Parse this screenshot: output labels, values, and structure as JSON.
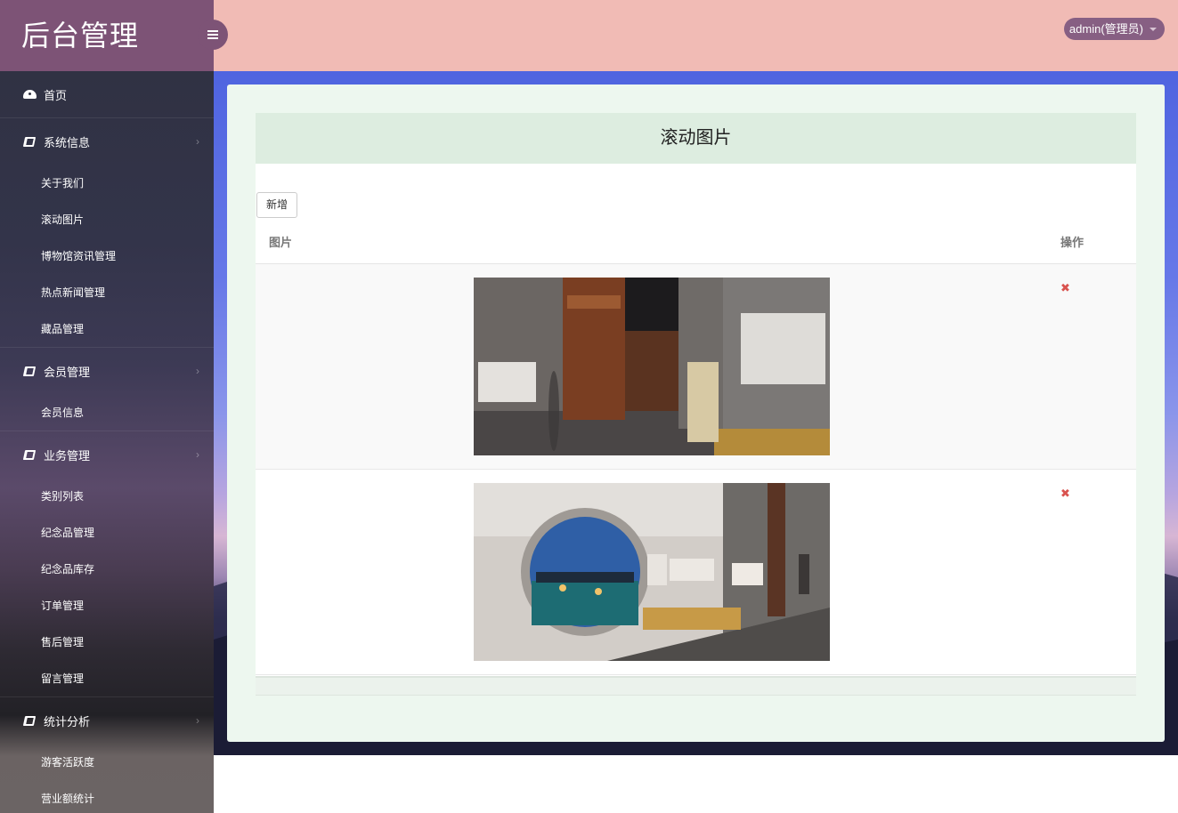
{
  "brand": {
    "title": "后台管理"
  },
  "topbar": {
    "user_label": "admin(管理员)"
  },
  "sidebar": {
    "home": {
      "label": "首页",
      "icon": "dashboard-icon"
    },
    "groups": [
      {
        "label": "系统信息",
        "icon": "book-icon",
        "items": [
          "关于我们",
          "滚动图片",
          "博物馆资讯管理",
          "热点新闻管理",
          "藏品管理"
        ]
      },
      {
        "label": "会员管理",
        "icon": "book-icon",
        "items": [
          "会员信息"
        ]
      },
      {
        "label": "业务管理",
        "icon": "book-icon",
        "items": [
          "类别列表",
          "纪念品管理",
          "纪念品库存",
          "订单管理",
          "售后管理",
          "留言管理"
        ]
      },
      {
        "label": "统计分析",
        "icon": "book-icon",
        "items": [
          "游客活跃度",
          "营业额统计"
        ]
      }
    ]
  },
  "panel": {
    "title": "滚动图片",
    "add_label": "新增",
    "columns": [
      "图片",
      "操作"
    ],
    "rows": [
      {
        "image": "museum-hall-photo",
        "action_icon": "delete-icon"
      },
      {
        "image": "moon-gate-garden-photo",
        "action_icon": "delete-icon"
      }
    ]
  },
  "colors": {
    "brand": "#7d5376",
    "topbar": "#f1bbb5",
    "danger": "#d9534f"
  }
}
